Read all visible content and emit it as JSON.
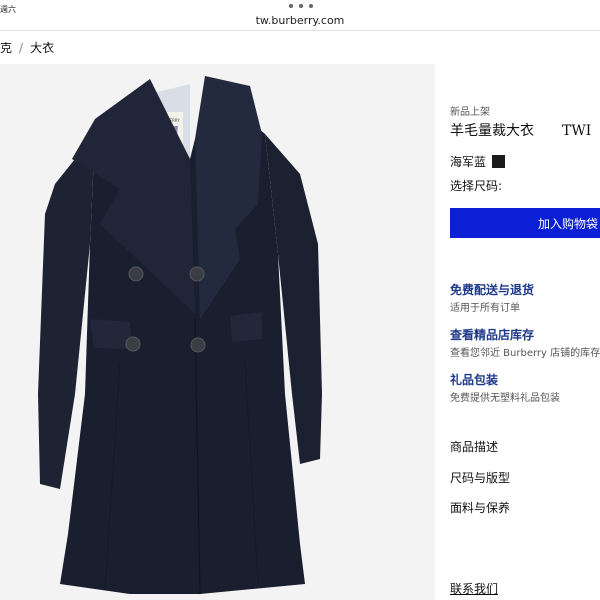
{
  "status": {
    "time": "週六"
  },
  "browser": {
    "url": "tw.burberry.com"
  },
  "breadcrumb": {
    "items": [
      "克",
      "大衣"
    ],
    "separator": "/"
  },
  "product": {
    "label_new": "新品上架",
    "name": "羊毛量裁大衣",
    "name_suffix": "TWI",
    "color_label": "海军蓝",
    "color_swatch": "#1b1b1b",
    "size_label": "选择尺码:",
    "add_to_bag": "加入购物袋",
    "image_label": "BURBERRY"
  },
  "services": [
    {
      "title": "免费配送与退货",
      "subtitle": "适用于所有订单"
    },
    {
      "title": "查看精品店库存",
      "subtitle": "查看您邻近 Burberry 店铺的库存"
    },
    {
      "title": "礼品包装",
      "subtitle": "免费提供无塑料礼品包装"
    }
  ],
  "accordion": [
    "商品描述",
    "尺码与版型",
    "面料与保养"
  ],
  "contact": "联系我们",
  "colors": {
    "accent": "#0b1fd6",
    "link": "#1f3a8a",
    "coat": "#1c2131"
  }
}
